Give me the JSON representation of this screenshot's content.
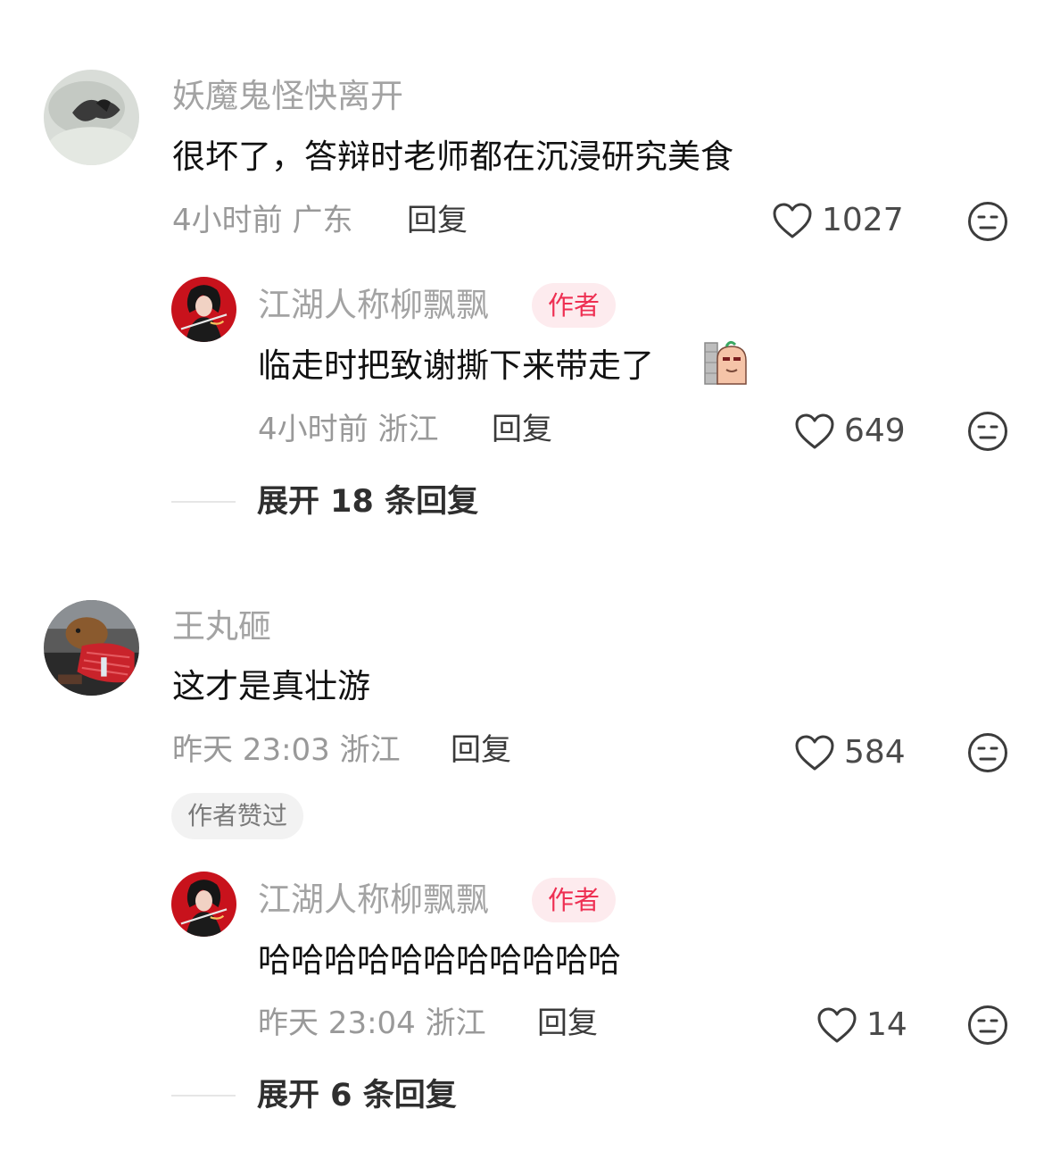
{
  "comments": [
    {
      "username": "妖魔鬼怪快离开",
      "text": "很坏了，答辩时老师都在沉浸研究美食",
      "meta": "4小时前 广东",
      "reply_label": "回复",
      "likes": "1027",
      "replies": [
        {
          "username": "江湖人称柳飘飘",
          "author_tag": "作者",
          "text": "临走时把致谢撕下来带走了",
          "sticker": "peeking-sticker",
          "meta": "4小时前 浙江",
          "reply_label": "回复",
          "likes": "649"
        }
      ],
      "expand_label": "展开 18 条回复"
    },
    {
      "username": "王丸砸",
      "text": "这才是真壮游",
      "meta": "昨天 23:03 浙江",
      "reply_label": "回复",
      "likes": "584",
      "liked_by_author": "作者赞过",
      "replies": [
        {
          "username": "江湖人称柳飘飘",
          "author_tag": "作者",
          "text": "哈哈哈哈哈哈哈哈哈哈哈",
          "meta": "昨天 23:04 浙江",
          "reply_label": "回复",
          "likes": "14"
        }
      ],
      "expand_label": "展开 6 条回复"
    }
  ],
  "icons": {
    "like": "heart-outline-icon",
    "emoji": "meh-face-icon"
  },
  "colors": {
    "author_tag_bg": "#fdebee",
    "author_tag_text": "#ee2f52",
    "username": "#a3a3a3",
    "meta": "#999999"
  }
}
